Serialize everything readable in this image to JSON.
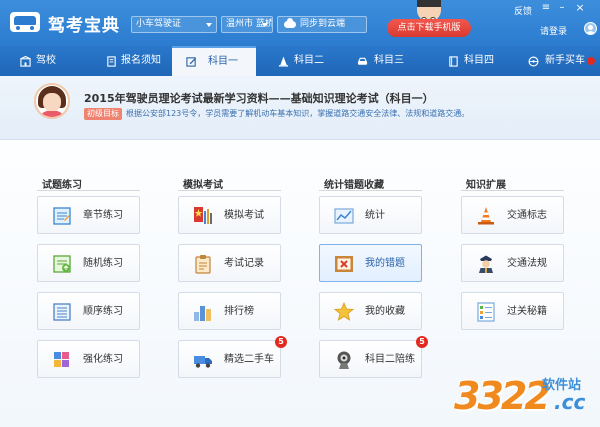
{
  "window": {
    "title": "驾考宝典",
    "feedback": "反馈",
    "login": "请登录"
  },
  "toolbar": {
    "license_select": "小车驾驶证",
    "school_select": "温州市 蓝桥驾校",
    "sync_label": "同步到云端",
    "download_label": "点击下载手机版"
  },
  "nav": {
    "tabs": [
      {
        "label": "驾校",
        "icon": "school-icon"
      },
      {
        "label": "报名须知",
        "icon": "notice-icon"
      },
      {
        "label": "科目一",
        "icon": "edit-icon"
      },
      {
        "label": "科目二",
        "icon": "cone-icon"
      },
      {
        "label": "科目三",
        "icon": "car-icon"
      },
      {
        "label": "科目四",
        "icon": "book-icon"
      },
      {
        "label": "新手买车",
        "icon": "steering-wheel-icon"
      }
    ],
    "active": "科目一"
  },
  "banner": {
    "title": "2015年驾驶员理论考试最新学习资料——基础知识理论考试（科目一）",
    "level": "初级目标",
    "description": "根据公安部123号令，学员需要了解机动车基本知识，掌握道路交通安全法律、法规和道路交通。"
  },
  "columns": [
    {
      "heading": "试题练习",
      "items": [
        {
          "label": "章节练习",
          "icon": "chapter-icon"
        },
        {
          "label": "随机练习",
          "icon": "random-icon"
        },
        {
          "label": "顺序练习",
          "icon": "sequence-icon"
        },
        {
          "label": "强化练习",
          "icon": "blocks-icon"
        }
      ]
    },
    {
      "heading": "模拟考试",
      "items": [
        {
          "label": "模拟考试",
          "icon": "exam-icon"
        },
        {
          "label": "考试记录",
          "icon": "clipboard-icon"
        },
        {
          "label": "排行榜",
          "icon": "ranking-icon"
        },
        {
          "label": "精选二手车",
          "icon": "truck-icon",
          "badge": "5"
        }
      ]
    },
    {
      "heading": "统计错题收藏",
      "items": [
        {
          "label": "统计",
          "icon": "chart-icon"
        },
        {
          "label": "我的错题",
          "icon": "error-icon",
          "selected": true
        },
        {
          "label": "我的收藏",
          "icon": "star-icon"
        },
        {
          "label": "科目二陪练",
          "icon": "coach-icon",
          "badge": "5"
        }
      ]
    },
    {
      "heading": "知识扩展",
      "items": [
        {
          "label": "交通标志",
          "icon": "traffic-cone-icon"
        },
        {
          "label": "交通法规",
          "icon": "police-icon"
        },
        {
          "label": "过关秘籍",
          "icon": "checklist-icon"
        }
      ]
    }
  ],
  "watermark": {
    "digits": "3322",
    "site": "软件站",
    "suffix": ".cc"
  },
  "colors": {
    "titlebar": "#2b7bd0",
    "navbar": "#1f66b7",
    "accent_red": "#e22a20",
    "selected_border": "#7fb4ea"
  }
}
